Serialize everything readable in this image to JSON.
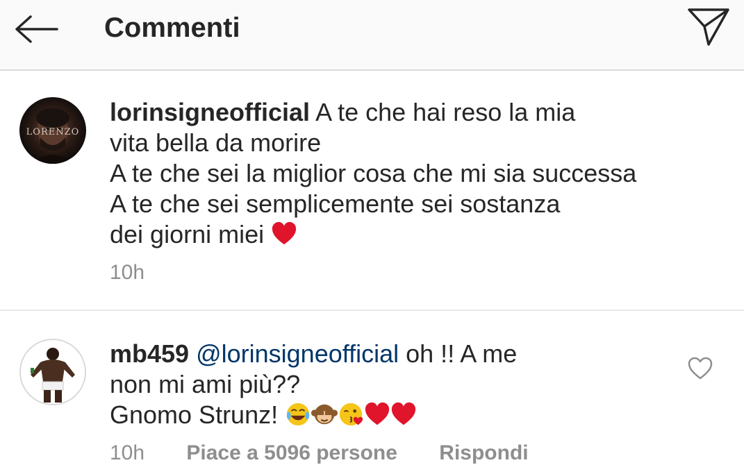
{
  "header": {
    "title": "Commenti",
    "back_icon": "back-arrow-icon",
    "share_icon": "send-icon"
  },
  "comments": [
    {
      "username": "lorinsigneofficial",
      "avatar_text": "LORENZO",
      "lines": [
        "A te che hai reso la mia",
        "vita bella da morire",
        "A te che sei la miglior cosa che mi sia successa",
        "A te che sei semplicemente sei sostanza",
        "dei giorni miei"
      ],
      "emojis": [
        "red-heart-emoji"
      ],
      "time": "10h"
    },
    {
      "username": "mb459",
      "mention": "@lorinsigneofficial",
      "lines": [
        "oh !! A me",
        "non mi ami più??",
        "Gnomo Strunz!"
      ],
      "emojis": [
        "tears-of-joy-emoji",
        "see-no-evil-monkey-emoji",
        "kissing-heart-emoji",
        "red-heart-emoji",
        "red-heart-emoji"
      ],
      "time": "10h",
      "likes": "Piace a 5096 persone",
      "reply": "Rispondi"
    }
  ],
  "colors": {
    "text": "#262626",
    "muted": "#8e8e8e",
    "mention": "#003569",
    "heart": "#e0142b",
    "header_bg": "#fafafa"
  }
}
